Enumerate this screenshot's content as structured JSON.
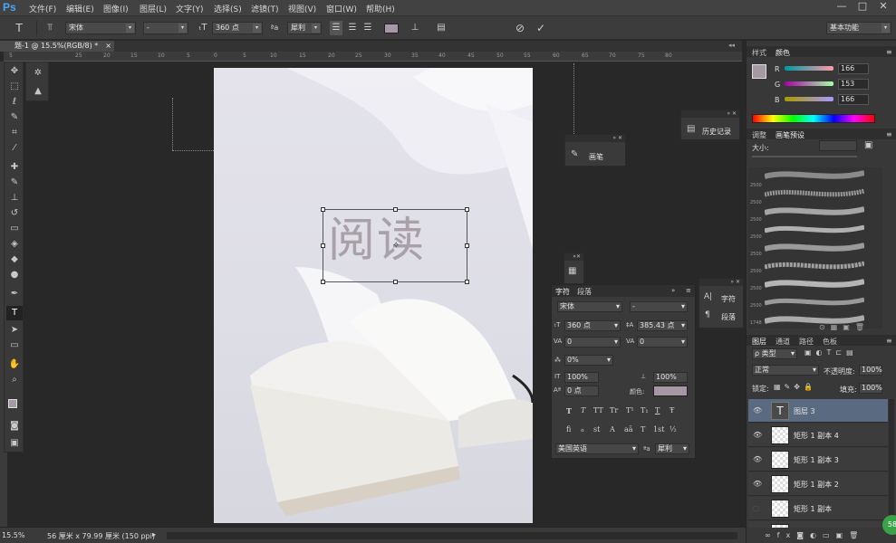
{
  "app": {
    "logo": "Ps"
  },
  "menu": [
    "文件(F)",
    "编辑(E)",
    "图像(I)",
    "图层(L)",
    "文字(Y)",
    "选择(S)",
    "滤镜(T)",
    "视图(V)",
    "窗口(W)",
    "帮助(H)"
  ],
  "window_controls": {
    "minimize": "—",
    "maximize": "□",
    "close": "✕"
  },
  "options": {
    "font_family": "宋体",
    "font_style": "-",
    "font_size": "360 点",
    "aa_label": "ªa",
    "antialias": "犀利",
    "workspace": "基本功能"
  },
  "document": {
    "tab_title": "题-1 @ 15.5%(RGB/8) *",
    "close": "×"
  },
  "ruler_ticks": [
    "5",
    "25",
    "20",
    "15",
    "10",
    "5",
    "0",
    "5",
    "10",
    "15",
    "20",
    "25",
    "30",
    "35",
    "40",
    "45",
    "50",
    "55",
    "60",
    "65",
    "70",
    "75",
    "80"
  ],
  "canvas": {
    "headline": "阅读"
  },
  "panels": {
    "brush": {
      "label": "画笔"
    },
    "history": {
      "label": "历史记录"
    },
    "char_mini": {
      "char": "字符",
      "para": "段落"
    }
  },
  "character": {
    "tab_char": "字符",
    "tab_para": "段落",
    "font_family": "宋体",
    "font_style": "-",
    "size": "360 点",
    "leading": "385.43 点",
    "kerning": "0",
    "tracking": "0",
    "scale_pct": "0%",
    "vscale": "100%",
    "hscale": "100%",
    "baseline": "0 点",
    "color_label": "颜色:",
    "glyphs": [
      "T",
      "T",
      "TT",
      "Tr",
      "T¹",
      "T₁",
      "T",
      "Ŧ"
    ],
    "glyphs2": [
      "fi",
      "ℴ",
      "st",
      "A",
      "aā",
      "T",
      "1st",
      "½"
    ],
    "language": "美国英语",
    "aa_label": "ªa",
    "antialias": "犀利"
  },
  "color_panel": {
    "tab_samples": "样式",
    "tab_color": "颜色",
    "r_label": "R",
    "r": "166",
    "g_label": "G",
    "g": "153",
    "b_label": "B",
    "b": "166",
    "fg_color": "#a699a6"
  },
  "brush_presets": {
    "tab_adjust": "调整",
    "tab_preset": "画笔预设",
    "size_label": "大小:",
    "sizes": [
      "2500",
      "2500",
      "2500",
      "2500",
      "2500",
      "2500",
      "2500",
      "2500",
      "1748"
    ]
  },
  "layers_panel": {
    "tabs": [
      "图层",
      "通道",
      "路径",
      "色板"
    ],
    "kind": "ρ 类型",
    "blend": "正常",
    "opacity_label": "不透明度:",
    "opacity": "100%",
    "lock_label": "锁定:",
    "fill_label": "填充:",
    "fill": "100%",
    "layers": [
      {
        "name": "图层 3",
        "type": "text",
        "selected": true,
        "visible": true
      },
      {
        "name": "矩形 1 副本 4",
        "type": "shape",
        "selected": false,
        "visible": true
      },
      {
        "name": "矩形 1 副本 3",
        "type": "shape",
        "selected": false,
        "visible": true
      },
      {
        "name": "矩形 1 副本 2",
        "type": "shape",
        "selected": false,
        "visible": true
      },
      {
        "name": "矩形 1 副本",
        "type": "shape",
        "selected": false,
        "visible": false
      }
    ]
  },
  "status": {
    "zoom": "15.5%",
    "doc_info": "56 厘米 x 79.99 厘米 (150 ppi)",
    "badge": "58"
  }
}
